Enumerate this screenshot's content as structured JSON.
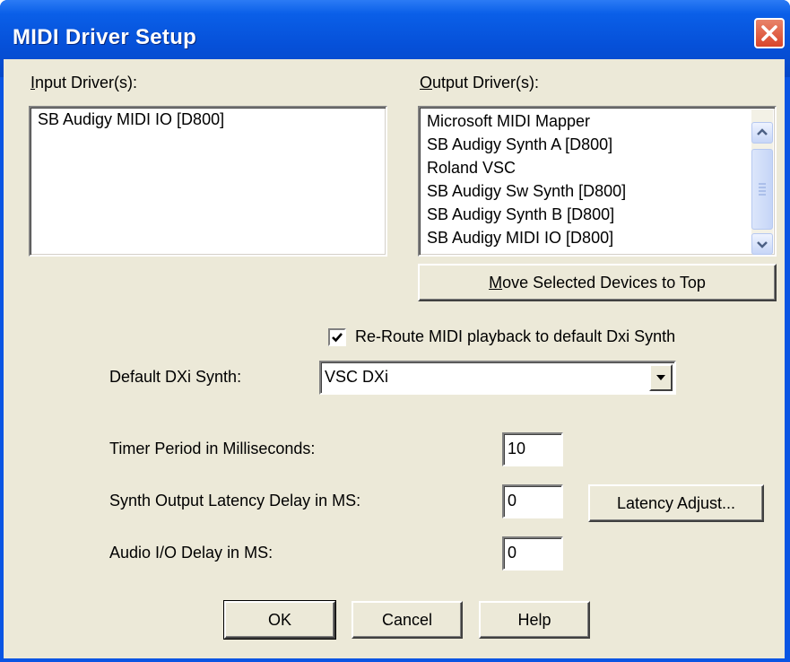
{
  "window": {
    "title": "MIDI Driver Setup"
  },
  "input": {
    "label_accel": "I",
    "label_rest": "nput Driver(s):",
    "items": [
      "SB Audigy MIDI IO [D800]"
    ]
  },
  "output": {
    "label_accel": "O",
    "label_rest": "utput Driver(s):",
    "items": [
      "Microsoft MIDI Mapper",
      "SB Audigy Synth A [D800]",
      "Roland VSC",
      "SB Audigy Sw Synth [D800]",
      "SB Audigy Synth B [D800]",
      "SB Audigy MIDI IO [D800]"
    ]
  },
  "move_button": {
    "accel": "M",
    "rest": "ove Selected Devices to Top"
  },
  "reroute": {
    "label": "Re-Route MIDI playback to default Dxi Synth",
    "checked": true
  },
  "dxi": {
    "label": "Default DXi Synth:",
    "value": "VSC DXi"
  },
  "timer": {
    "label": "Timer Period in Milliseconds:",
    "value": "10"
  },
  "synth_latency": {
    "label": "Synth Output Latency Delay in MS:",
    "value": "0"
  },
  "latency_button": {
    "label": "Latency Adjust..."
  },
  "audio_delay": {
    "label": "Audio I/O Delay in MS:",
    "value": "0"
  },
  "buttons": {
    "ok": "OK",
    "cancel": "Cancel",
    "help": "Help"
  }
}
